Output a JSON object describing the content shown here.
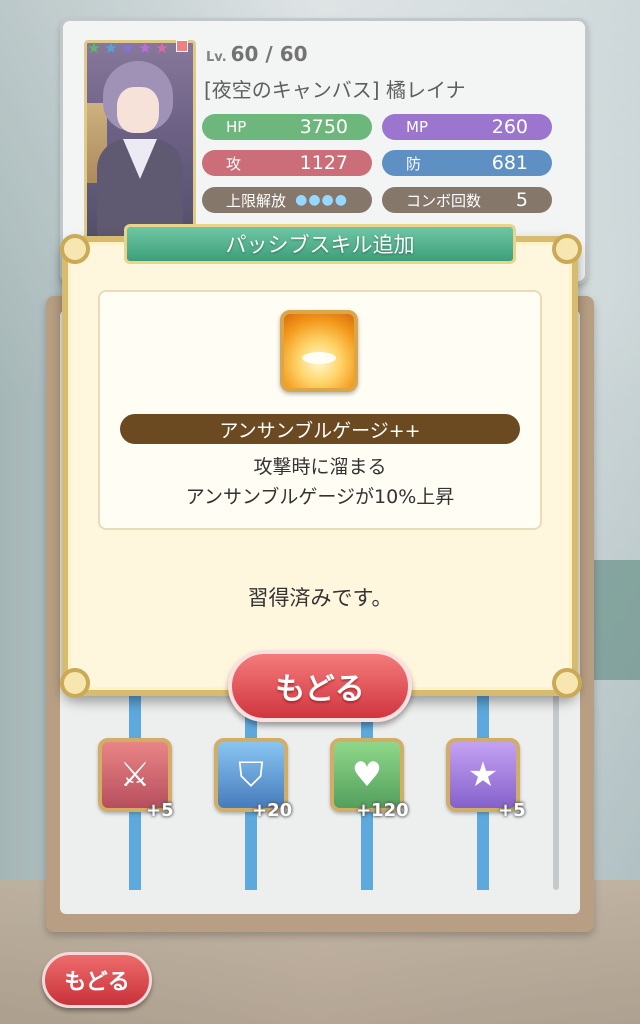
{
  "card": {
    "stars": [
      "★",
      "★",
      "★",
      "★",
      "★"
    ],
    "level_prefix": "Lv.",
    "level": "60 / 60",
    "name": "[夜空のキャンバス] 橘レイナ",
    "stats": {
      "hp_label": "HP",
      "hp_value": "3750",
      "mp_label": "MP",
      "mp_value": "260",
      "atk_label": "攻",
      "atk_value": "1127",
      "def_label": "防",
      "def_value": "681",
      "limit_label": "上限解放",
      "limit_dots": "●●●●",
      "combo_label": "コンボ回数",
      "combo_value": "5"
    }
  },
  "board": {
    "skills": [
      {
        "icon": "sword-icon",
        "plus": "+5"
      },
      {
        "icon": "shield-icon",
        "plus": "+20"
      },
      {
        "icon": "heart-icon",
        "plus": "+120"
      },
      {
        "icon": "star-icon",
        "plus": "+5"
      }
    ]
  },
  "modal": {
    "title": "パッシブスキル追加",
    "skill_name": "アンサンブルゲージ++",
    "desc_line1": "攻撃時に溜まる",
    "desc_line2": "アンサンブルゲージが10%上昇",
    "status": "習得済みです。",
    "back_label": "もどる"
  },
  "footer": {
    "back_label": "もどる"
  },
  "colors": {
    "accent_red": "#d0363f",
    "header_green": "#3d9f7a",
    "frame_gold": "#d7bb6e"
  }
}
